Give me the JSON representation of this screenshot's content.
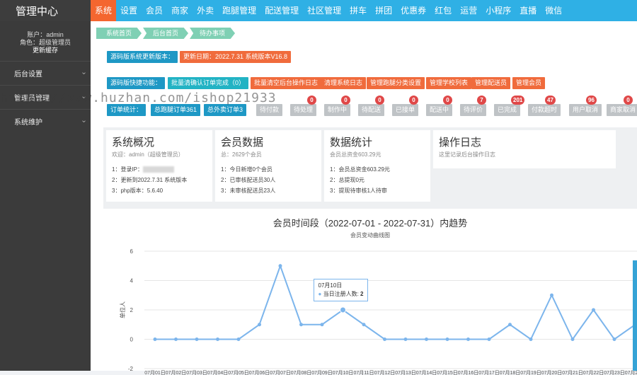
{
  "brand": "管理中心",
  "menu": [
    "系统",
    "设置",
    "会员",
    "商家",
    "外卖",
    "跑腿管理",
    "配送管理",
    "社区管理",
    "拼车",
    "拼团",
    "优惠券",
    "红包",
    "运营",
    "小程序",
    "直播",
    "微信"
  ],
  "account": {
    "user": "账户：admin",
    "role": "角色：超级管理员",
    "cache": "更新缓存"
  },
  "sidebar": [
    {
      "label": "后台设置"
    },
    {
      "label": "管理员管理"
    },
    {
      "label": "系统维护"
    }
  ],
  "breadcrumb": [
    "系统首页",
    "后台首页",
    "待办事项"
  ],
  "version": {
    "label": "源码版系统更新版本：",
    "date": "更新日期：2022.7.31 系统版本V16.8"
  },
  "quick": {
    "label": "源码版快捷功能：",
    "buttons": [
      "批量清确认订单完成（0）",
      "批量清空后台操作日志",
      "清理系统日志",
      "管理跑腿分类设置",
      "管理学校列表",
      "管理配送员",
      "管理会员"
    ]
  },
  "orders": {
    "label": "订单统计：",
    "total_errand": "总跑腿订单361",
    "total_takeout": "总外卖订单3",
    "statuses": [
      {
        "label": "待付款",
        "badge": ""
      },
      {
        "label": "待处理",
        "badge": "0"
      },
      {
        "label": "制作中",
        "badge": "0"
      },
      {
        "label": "待配送",
        "badge": "0"
      },
      {
        "label": "已接单",
        "badge": "0"
      },
      {
        "label": "配送中",
        "badge": "0"
      },
      {
        "label": "待评价",
        "badge": "7"
      },
      {
        "label": "已完成",
        "badge": "201"
      },
      {
        "label": "付款超时",
        "badge": "47"
      },
      {
        "label": "用户取消",
        "badge": "96"
      },
      {
        "label": "商家取消",
        "badge": "0"
      }
    ]
  },
  "watermark": "https://www.huzhan.com/ishop21933",
  "cards": [
    {
      "title": "系统概况",
      "sub": "欢迎：admin（超级管理员）",
      "lines": [
        "1：登录IP：",
        "2：更新到2022.7.31 系统版本",
        "3：php版本：5.6.40"
      ]
    },
    {
      "title": "会员数据",
      "sub": "总：2629个会员",
      "lines": [
        "1：今日新增0个会员",
        "2：已审核配送员30人",
        "3：未审核配送员23人"
      ]
    },
    {
      "title": "数据统计",
      "sub": "会员总资金603.29元",
      "lines": [
        "1：会员总资金603.29元",
        "2：总提现0元",
        "3：提现待审核1人待审"
      ]
    },
    {
      "title": "操作日志",
      "sub": "这里记录后台操作日志",
      "lines": []
    }
  ],
  "colors": {
    "topbar": "#2fb0e5",
    "active": "#f4662f",
    "sidebar": "#3b3b3b",
    "line": "#7cb5ec"
  },
  "chart_data": {
    "type": "line",
    "title": "会员时间段（2022-07-01 - 2022-07-31）内趋势",
    "subtitle": "会员变动曲线图",
    "ylabel": "单位人",
    "ylim": [
      -2,
      6
    ],
    "yticks": [
      -2,
      0,
      2,
      4,
      6
    ],
    "x": [
      "07月01日",
      "07月02日",
      "07月03日",
      "07月04日",
      "07月05日",
      "07月06日",
      "07月07日",
      "07月08日",
      "07月09日",
      "07月10日",
      "07月11日",
      "07月12日",
      "07月13日",
      "07月14日",
      "07月15日",
      "07月16日",
      "07月17日",
      "07月18日",
      "07月19日",
      "07月20日",
      "07月21日",
      "07月22日",
      "07月23日",
      "07月24日",
      "07月25日"
    ],
    "series": [
      {
        "name": "当日注册人数",
        "values": [
          0,
          0,
          0,
          0,
          0,
          1,
          5,
          1,
          1,
          2,
          1,
          0,
          0,
          0,
          0,
          0,
          0,
          1,
          0,
          3,
          0,
          2,
          0,
          1,
          0
        ]
      }
    ],
    "tooltip": {
      "date": "07月10日",
      "label": "当日注册人数",
      "value": "2"
    }
  }
}
